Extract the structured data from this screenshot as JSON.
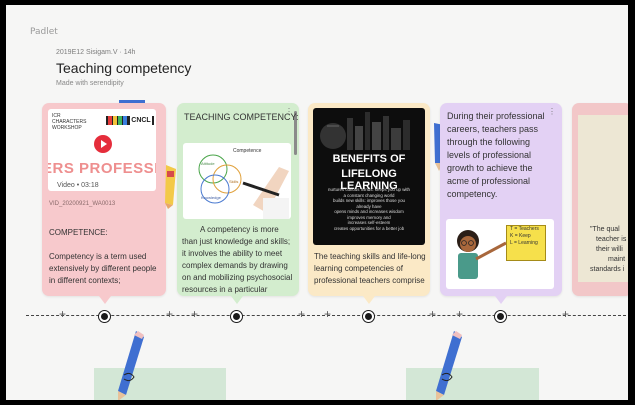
{
  "app": {
    "brand": "Padlet"
  },
  "board": {
    "meta": "2019E12 Sisigam.V · 14h",
    "title": "Teaching competency",
    "subtitle": "Made with serendipity"
  },
  "cards": [
    {
      "video_top": "ICR\nCHARACTERS\nWORKSHOP",
      "video_banner": "ERS PROFESSIONAL",
      "video_badge": "Video • 03:18",
      "video_file": "VID_20200921_WA0013",
      "heading": "COMPETENCE:",
      "body": "Competency is a term used extensively by different people in different contexts;"
    },
    {
      "heading": "TEACHING COMPETENCY:",
      "diagram_labels": [
        "Competence",
        "Attitude",
        "Skills",
        "Knowledge"
      ],
      "body": "A competency is more than just knowledge and skills; it involves the ability to meet complex demands by drawing on and mobilizing psychosocial resources in a particular context"
    },
    {
      "poster_title_1": "BENEFITS OF",
      "poster_title_2": "LIFELONG LEARNING",
      "poster_lines": [
        "nurtures curious minds: keeps you up with",
        "a constant changing world",
        "builds new skills: improves those you",
        "already have",
        "opens minds and increases wisdom",
        "improves memory and",
        "increases self-esteem",
        "creates opportunities for a better job"
      ],
      "body": "The teaching skills and life-long learning competencies of professional teachers comprise"
    },
    {
      "body": "During their professional careers, teachers pass through the following levels of professional growth to achieve the acme of professional competency.",
      "board_lines": [
        "T = Teachers",
        "K = Keep",
        "L = Learning"
      ]
    },
    {
      "body_lines": [
        "\"The qual",
        "teacher is",
        "their willi",
        "maint",
        "standards i"
      ]
    }
  ],
  "colors": {
    "card_pink": "#f7c9cc",
    "card_green": "#d3edce",
    "card_yellow": "#fbe9c6",
    "card_purple": "#e3d1f4",
    "timeline": "#1a1a1a"
  },
  "icons": [
    "play-icon",
    "more-icon",
    "plus-icon",
    "pencil-icon"
  ]
}
